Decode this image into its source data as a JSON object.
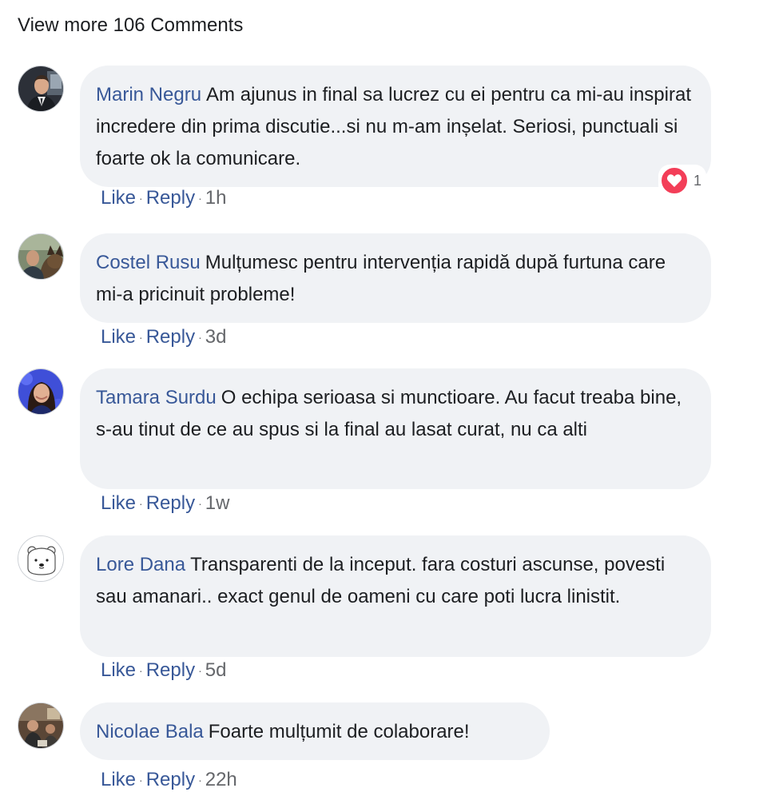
{
  "view_more": "View more 106 Comments",
  "actions": {
    "like": "Like",
    "reply": "Reply",
    "separator": "·"
  },
  "colors": {
    "author": "#385898",
    "action": "#385898",
    "bubble": "#f0f2f5",
    "reaction_heart": "#f33e58"
  },
  "comments": [
    {
      "author": "Marin Negru",
      "text": "Am ajunus in final sa lucrez cu ei pentru ca mi-au inspirat incredere din prima discutie...si nu m-am inșelat. Seriosi, punctuali si foarte ok la comunicare.",
      "time": "1h",
      "reaction_icon": "love-reaction-icon",
      "reaction_count": "1",
      "avatar": "profile-photo-man-suit"
    },
    {
      "author": "Costel Rusu",
      "text": "Mulțumesc pentru intervenția rapidă după furtuna care mi-a pricinuit probleme!",
      "time": "3d",
      "avatar": "profile-photo-man-with-dog"
    },
    {
      "author": "Tamara Surdu",
      "text": "O echipa serioasa si munctioare. Au facut treaba bine, s-au tinut de ce au spus si la final au lasat curat, nu ca alti",
      "time": "1w",
      "avatar": "profile-photo-woman-blue"
    },
    {
      "author": "Lore Dana",
      "text": "Transparenti de la inceput. fara costuri ascunse, povesti sau amanari.. exact genul de oameni cu care poti lucra linistit.",
      "time": "5d",
      "avatar": "profile-illustration-polar-bear"
    },
    {
      "author": "Nicolae Bala",
      "text": "Foarte mulțumit de colaborare!",
      "time": "22h",
      "avatar": "profile-photo-people-indoor"
    }
  ]
}
